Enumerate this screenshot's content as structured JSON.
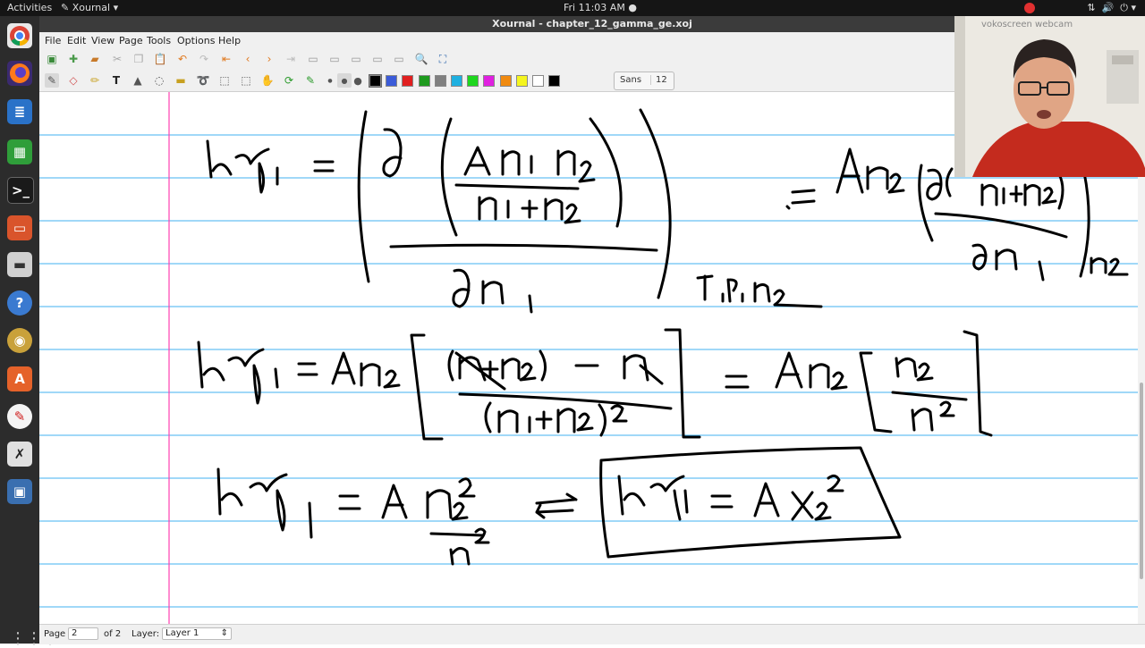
{
  "topbar": {
    "activities": "Activities",
    "app_menu": "Xournal",
    "clock": "Fri 11:03 AM",
    "recording_indicator_color": "#e03030",
    "icons": [
      "screencast-record-icon",
      "network-icon",
      "volume-icon",
      "power-icon",
      "chevron-down-icon"
    ]
  },
  "window": {
    "title": "Xournal - chapter_12_gamma_ge.xoj"
  },
  "menubar": {
    "items": [
      "File",
      "Edit",
      "View",
      "Page",
      "Tools",
      "Options",
      "Help"
    ]
  },
  "toolbar": {
    "font_name": "Sans",
    "font_size": "12",
    "colors": [
      "#000000",
      "#3b5bd8",
      "#e01f1f",
      "#1e9a1e",
      "#808080",
      "#1fb0e0",
      "#1ed61e",
      "#e020e0",
      "#f08a10",
      "#f5f51e",
      "#ffffff",
      "#000000"
    ]
  },
  "statusbar": {
    "page_label": "Page",
    "page_value": "2",
    "page_total": "of 2",
    "layer_label": "Layer:",
    "layer_value": "Layer 1"
  },
  "webcam": {
    "label": "vokoscreen webcam"
  },
  "page_style": {
    "rule_color": "#40b0f0",
    "margin_color": "#ff40b0"
  }
}
